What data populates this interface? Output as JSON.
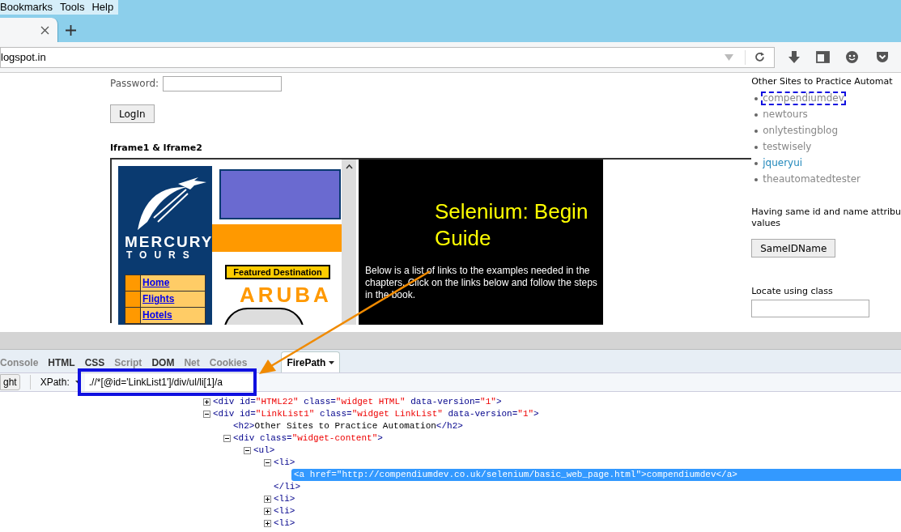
{
  "menu_bar": [
    {
      "label": "Bookmarks"
    },
    {
      "label": "Tools"
    },
    {
      "label": "Help"
    }
  ],
  "address_bar": {
    "value": "logspot.in"
  },
  "page": {
    "login": {
      "password_label": "Password:",
      "button": "LogIn"
    },
    "iframes_heading": "Iframe1 & Iframe2",
    "iframe_left": {
      "brand_line1": "MERCURY",
      "brand_line2": "TOURS",
      "featured": "Featured Destination",
      "destination": "ARUBA",
      "nav_links": [
        "Home",
        "Flights",
        "Hotels"
      ]
    },
    "iframe_right": {
      "title": [
        "Selenium: Begin",
        "Guide"
      ],
      "paragraph": "Below is a list of links to the examples needed in the chapters. Click on the links below and follow the steps in the book."
    },
    "sidebar": {
      "heading": "Other Sites to Practice Automat",
      "links": [
        {
          "label": "compendiumdev",
          "focused": true,
          "color": "#888888"
        },
        {
          "label": "newtours",
          "focused": false,
          "color": "#888888"
        },
        {
          "label": "onlytestingblog",
          "focused": false,
          "color": "#888888"
        },
        {
          "label": "testwisely",
          "focused": false,
          "color": "#888888"
        },
        {
          "label": "jqueryui",
          "focused": false,
          "color": "#2288bb"
        },
        {
          "label": "theautomatedtester",
          "focused": false,
          "color": "#888888"
        }
      ],
      "same_id_heading": [
        "Having same id and name attribu",
        "values"
      ],
      "same_id_button": "SameIDName",
      "locate_heading": "Locate using class"
    }
  },
  "firebug": {
    "tabs": [
      {
        "label": "Console",
        "selected": false,
        "disabled": true
      },
      {
        "label": "HTML",
        "selected": false,
        "disabled": false
      },
      {
        "label": "CSS",
        "selected": false,
        "disabled": false
      },
      {
        "label": "Script",
        "selected": false,
        "disabled": true
      },
      {
        "label": "DOM",
        "selected": false,
        "disabled": false
      },
      {
        "label": "Net",
        "selected": false,
        "disabled": true
      },
      {
        "label": "Cookies",
        "selected": false,
        "disabled": true
      },
      {
        "label": "FirePath",
        "selected": true,
        "disabled": false
      }
    ],
    "toolbar": {
      "highlight_button": "ght",
      "xpath_label": "XPath:",
      "xpath_value": ".//*[@id='LinkList1']/div/ul/li[1]/a"
    },
    "tree": [
      {
        "kind": "element",
        "text": "<div id=\"HTML22\" class=\"widget HTML\" data-version=\"1\">",
        "expanded": false,
        "selected": false
      },
      {
        "kind": "element",
        "text": "<div id=\"LinkList1\" class=\"widget LinkList\" data-version=\"1\">",
        "expanded": true,
        "selected": false,
        "children": [
          {
            "kind": "leaf",
            "text": "<h2>Other Sites to Practice Automation</h2>",
            "selected": false
          },
          {
            "kind": "element",
            "text": "<div class=\"widget-content\">",
            "expanded": true,
            "selected": false,
            "children": [
              {
                "kind": "element",
                "text": "<ul>",
                "expanded": true,
                "selected": false,
                "children": [
                  {
                    "kind": "element",
                    "text": "<li>",
                    "expanded": true,
                    "selected": false,
                    "close": "</li>",
                    "children": [
                      {
                        "kind": "leaf",
                        "text": "<a href=\"http://compendiumdev.co.uk/selenium/basic_web_page.html\">compendiumdev</a>",
                        "selected": true
                      }
                    ]
                  },
                  {
                    "kind": "element",
                    "text": "<li>",
                    "expanded": false,
                    "selected": false
                  },
                  {
                    "kind": "element",
                    "text": "<li>",
                    "expanded": false,
                    "selected": false
                  },
                  {
                    "kind": "element",
                    "text": "<li>",
                    "expanded": false,
                    "selected": false
                  }
                ]
              }
            ]
          }
        ]
      }
    ]
  },
  "annotations": {
    "highlight_box": true,
    "arrow": true
  }
}
